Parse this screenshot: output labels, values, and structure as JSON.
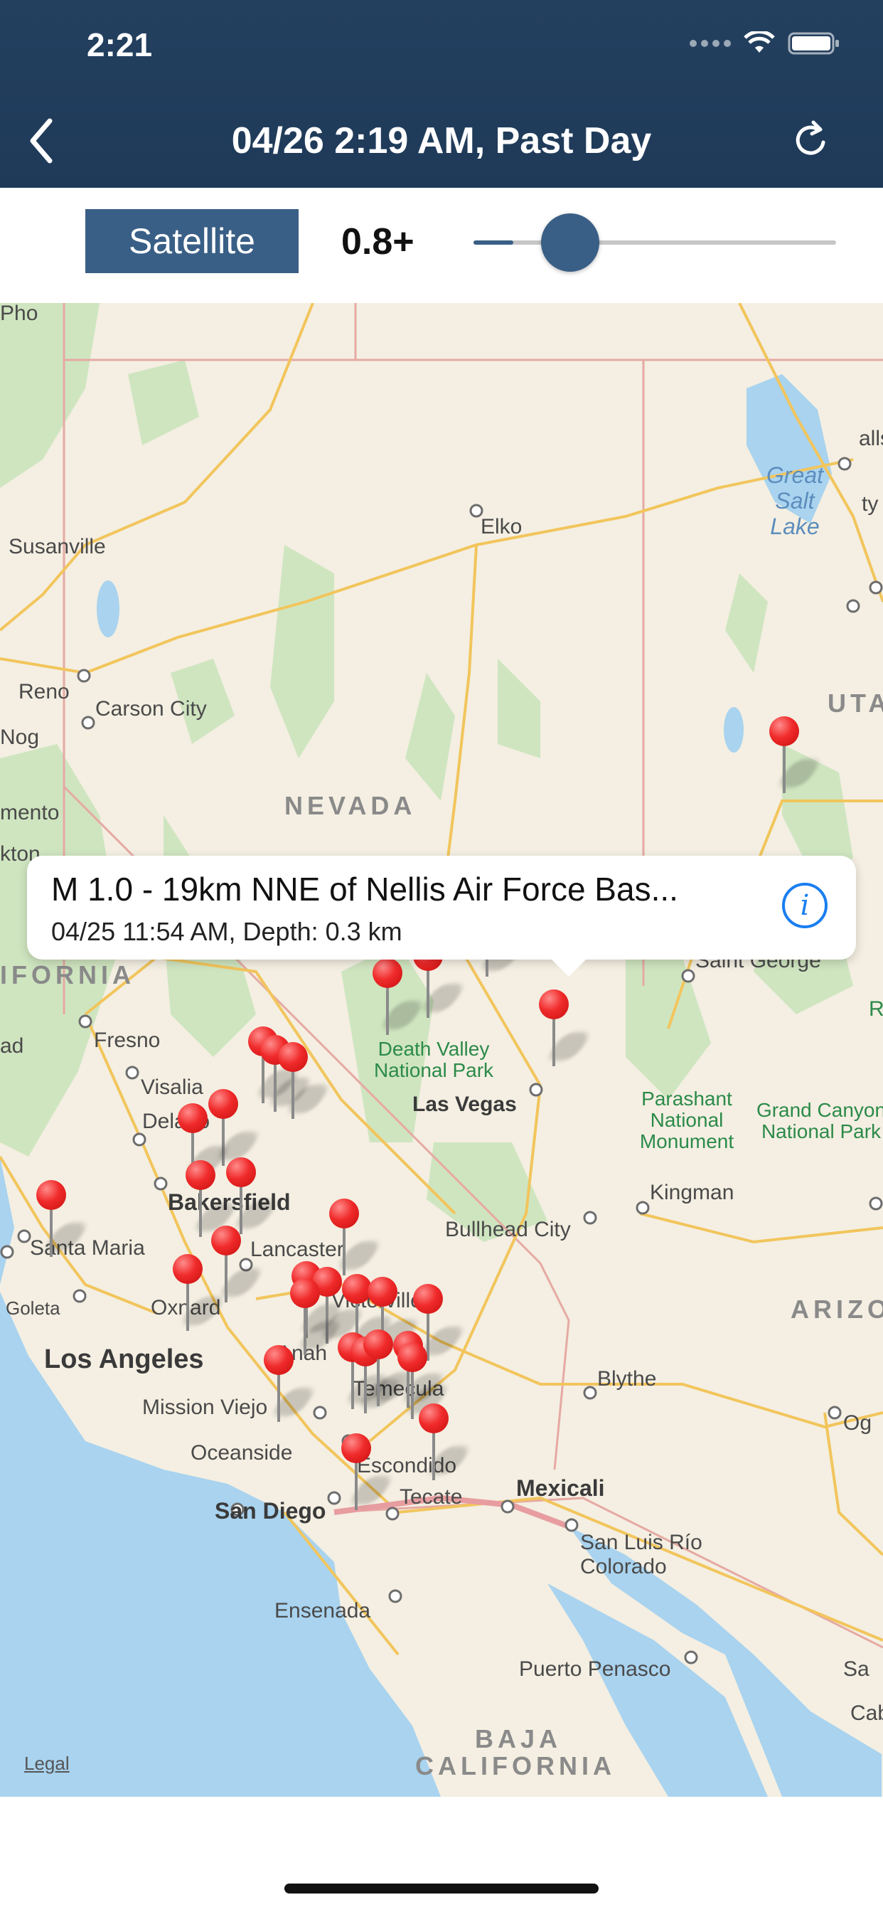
{
  "status_bar": {
    "time": "2:21"
  },
  "nav": {
    "title": "04/26 2:19 AM, Past Day"
  },
  "controls": {
    "map_type_label": "Satellite",
    "magnitude_label": "0.8+",
    "magnitude_slider_fraction": 0.11
  },
  "callout": {
    "title": "M 1.0 - 19km NNE of Nellis Air Force Bas...",
    "subtitle": "04/25 11:54 AM, Depth: 0.3 km"
  },
  "map": {
    "legal": "Legal",
    "states": [
      "NEVADA",
      "IFORNIA",
      "UTA",
      "ARIZO",
      "BAJA",
      "CALIFORNIA"
    ],
    "cities": [
      "Elko",
      "Susanville",
      "Reno",
      "Carson City",
      "mento",
      "kton",
      "Fresno",
      "Visalia",
      "Delano",
      "Bakersfield",
      "Santa Maria",
      "Lancaster",
      "Goleta",
      "Oxnard",
      "Victorville",
      "Mission Viejo",
      "Temecula",
      "Oceanside",
      "Escondido",
      "Tecate",
      "Mexicali",
      "Las Vegas",
      "Bullhead City",
      "Kingman",
      "Blythe",
      "Saint George",
      "San Luis Río Colorado",
      "Puerto Penasco",
      "Ensenada",
      "ad",
      "alls",
      "ty",
      "Og",
      "Sa",
      "Pho",
      "Nog",
      "Cabo",
      "Ro"
    ],
    "big_cities": [
      "Los Angeles",
      "San Diego",
      "Anah"
    ],
    "water": [
      "Great Salt Lake"
    ],
    "parks": [
      "Death Valley National Park",
      "Parashant National Monument",
      "Grand Canyon National Park"
    ]
  }
}
